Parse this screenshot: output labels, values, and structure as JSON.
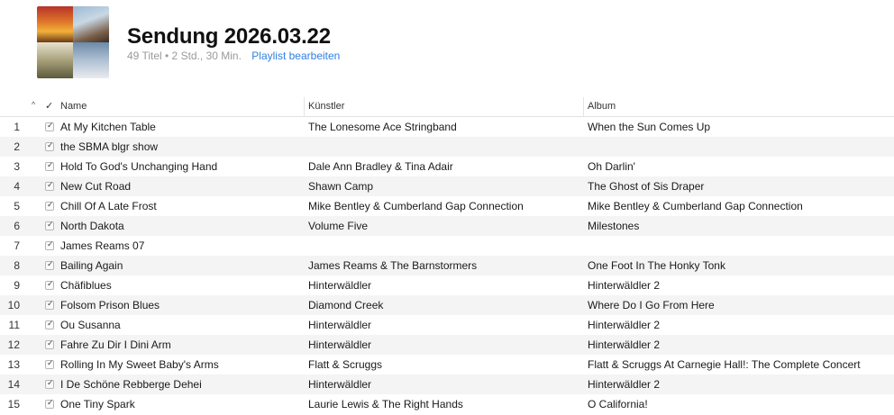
{
  "playlist": {
    "title": "Sendung 2026.03.22",
    "meta": "49 Titel • 2 Std., 30 Min.",
    "edit_label": "Playlist bearbeiten"
  },
  "columns": {
    "sort_indicator": "^",
    "check": "✓",
    "name": "Name",
    "artist": "Künstler",
    "album": "Album"
  },
  "rows": [
    {
      "num": "1",
      "name": "At My Kitchen Table",
      "artist": "The Lonesome Ace Stringband",
      "album": "When the Sun Comes Up",
      "checked": true
    },
    {
      "num": "2",
      "name": "the SBMA blgr show",
      "artist": "",
      "album": "",
      "checked": true
    },
    {
      "num": "3",
      "name": "Hold To God's Unchanging Hand",
      "artist": "Dale Ann Bradley & Tina Adair",
      "album": "Oh Darlin'",
      "checked": true
    },
    {
      "num": "4",
      "name": "New Cut Road",
      "artist": "Shawn Camp",
      "album": "The Ghost of Sis Draper",
      "checked": true
    },
    {
      "num": "5",
      "name": "Chill Of A Late Frost",
      "artist": "Mike Bentley & Cumberland Gap Connection",
      "album": "Mike Bentley & Cumberland Gap Connection",
      "checked": true
    },
    {
      "num": "6",
      "name": "North Dakota",
      "artist": "Volume Five",
      "album": "Milestones",
      "checked": true
    },
    {
      "num": "7",
      "name": "James Reams 07",
      "artist": "",
      "album": "",
      "checked": true
    },
    {
      "num": "8",
      "name": "Bailing Again",
      "artist": "James Reams & The Barnstormers",
      "album": "One Foot In The Honky Tonk",
      "checked": true
    },
    {
      "num": "9",
      "name": "Chäfiblues",
      "artist": "Hinterwäldler",
      "album": "Hinterwäldler 2",
      "checked": true
    },
    {
      "num": "10",
      "name": "Folsom Prison Blues",
      "artist": "Diamond Creek",
      "album": "Where Do I Go From Here",
      "checked": true
    },
    {
      "num": "11",
      "name": "Ou Susanna",
      "artist": "Hinterwäldler",
      "album": "Hinterwäldler 2",
      "checked": true
    },
    {
      "num": "12",
      "name": "Fahre Zu Dir I Dini Arm",
      "artist": "Hinterwäldler",
      "album": "Hinterwäldler 2",
      "checked": true
    },
    {
      "num": "13",
      "name": "Rolling In My Sweet Baby's Arms",
      "artist": "Flatt & Scruggs",
      "album": "Flatt & Scruggs At Carnegie Hall!: The Complete Concert",
      "checked": true
    },
    {
      "num": "14",
      "name": "I De Schöne Rebberge Dehei",
      "artist": "Hinterwäldler",
      "album": "Hinterwäldler 2",
      "checked": true
    },
    {
      "num": "15",
      "name": "One Tiny Spark",
      "artist": "Laurie Lewis & The Right Hands",
      "album": "O California!",
      "checked": true
    }
  ]
}
